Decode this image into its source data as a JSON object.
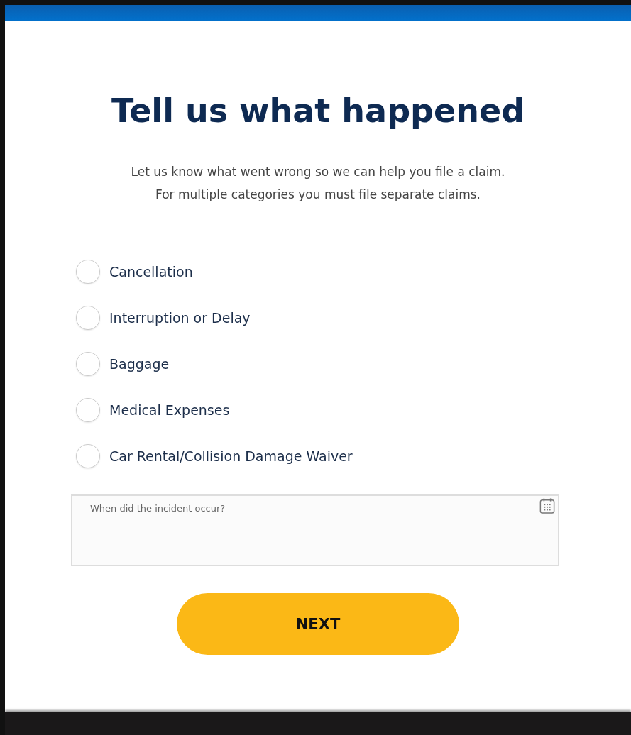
{
  "title": "Tell us what happened",
  "intro": [
    "Let us know what went wrong so we can help you file a claim.",
    "For multiple categories you must file separate claims."
  ],
  "options": [
    {
      "label": "Cancellation",
      "selected": false
    },
    {
      "label": "Interruption or Delay",
      "selected": false
    },
    {
      "label": "Baggage",
      "selected": false
    },
    {
      "label": "Medical Expenses",
      "selected": false
    },
    {
      "label": "Car Rental/Collision Damage Waiver",
      "selected": false
    }
  ],
  "date_field": {
    "placeholder": "When did the incident occur?"
  },
  "next_button": "NEXT"
}
